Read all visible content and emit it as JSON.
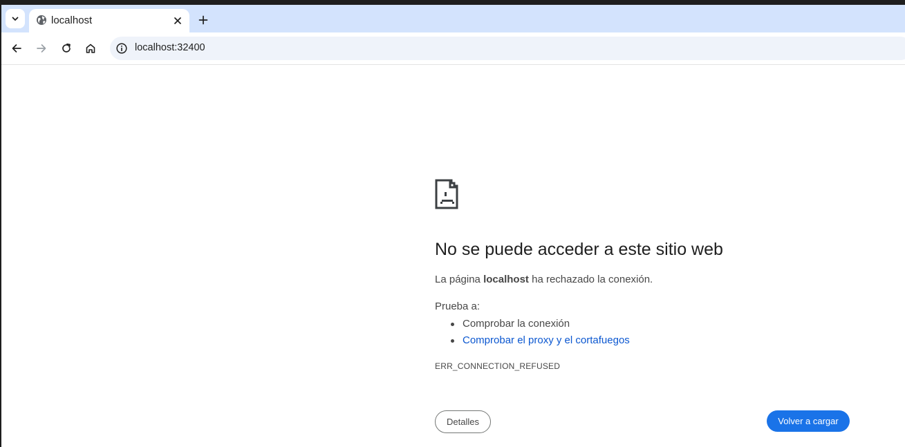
{
  "browser": {
    "tab": {
      "title": "localhost",
      "favicon": "globe-icon"
    },
    "address_bar": {
      "url": "localhost:32400"
    },
    "colors": {
      "tabbar": "#d3e3fd",
      "omnibox": "#eff3fa"
    }
  },
  "error_page": {
    "icon": "sad-page-icon",
    "title": "No se puede acceder a este sitio web",
    "description": {
      "prefix": "La página ",
      "host": "localhost",
      "suffix": " ha rechazado la conexión."
    },
    "try_label": "Prueba a:",
    "suggestions": [
      {
        "text": "Comprobar la conexión",
        "is_link": false
      },
      {
        "text": "Comprobar el proxy y el cortafuegos",
        "is_link": true
      }
    ],
    "error_code": "ERR_CONNECTION_REFUSED",
    "details_button": "Detalles",
    "reload_button": "Volver a cargar",
    "colors": {
      "link": "#0b57d0",
      "primary_button": "#1a73e8"
    }
  }
}
